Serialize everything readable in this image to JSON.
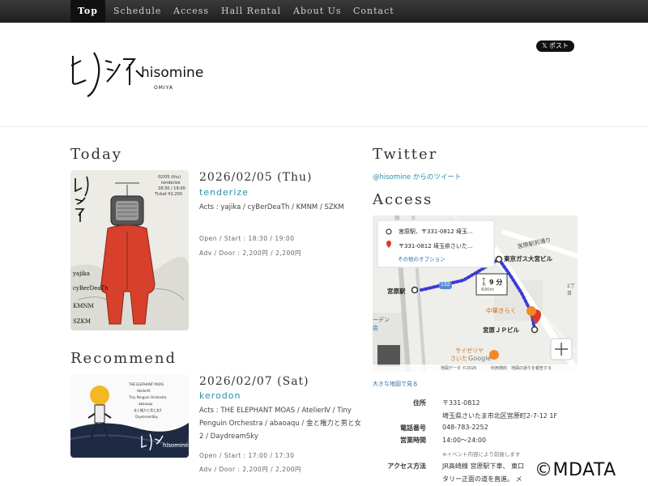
{
  "nav": {
    "items": [
      "Top",
      "Schedule",
      "Access",
      "Hall Rental",
      "About Us",
      "Contact"
    ]
  },
  "header": {
    "logo_text": "hisomine",
    "logo_sub": "OMIYA",
    "x_post": "𝕏 ポスト"
  },
  "today": {
    "heading": "Today",
    "date": "2026/02/05 (Thu)",
    "title": "tenderize",
    "acts": "Acts : yajika / cyBerDeaTh / KMNM / SZKM",
    "open_start": "Open / Start : 18:30 / 19:00",
    "adv_door": "Adv / Door : 2,200円 / 2,200円",
    "flyer": {
      "date": "02/05 (thu)",
      "title": "tenderize",
      "time": "18:30 / 19:00",
      "ticket": "Ticket ¥2,200",
      "names": [
        "yajika",
        "cyBerDeaTh",
        "KMNM",
        "SZKM"
      ]
    }
  },
  "recommend": {
    "heading": "Recommend",
    "date": "2026/02/07 (Sat)",
    "title": "kerodon",
    "acts": "Acts : THE ELEPHANT MOAS / AtelierⅣ / Tiny Penguin Orchestra / abaoaqu / 金と権力と男と女2 / DaydreamSky",
    "open_start": "Open / Start : 17:00 / 17:30",
    "adv_door": "Adv / Door : 2,200円 / 2,200円",
    "flyer": {
      "lines": [
        "THE ELEPHANT MOAS",
        "AtelierⅣ",
        "Tiny Penguin Orchestra",
        "abaoaqu",
        "金と権力と男と女2",
        "DaydreamSky"
      ]
    }
  },
  "twitter": {
    "heading": "Twitter",
    "link": "@hisomine からのツイート"
  },
  "access": {
    "heading": "Access",
    "map": {
      "from": "宮原駅、〒331-0812 埼玉...",
      "to": "〒331-0812 埼玉県さいた...",
      "options": "その他のオプション",
      "walk_time": "9 分",
      "walk_dist": "600m",
      "labels": {
        "tokyo_gas": "東京ガス大宮ビル",
        "miyahara_st": "宮原駅",
        "chuka": "中華きらく",
        "jp_bldg": "宮原ＪＰビル",
        "saizeriya": "サイゼリヤ",
        "saizeriya2": "さいた",
        "street": "宮原駅前通り",
        "chome": "2丁目",
        "route": "132",
        "den": "ーデン",
        "shop": "店",
        "google": "Google",
        "footer_left": "地図データ ©2026",
        "footer_right": "利用規約　地図の誤りを報告する"
      }
    },
    "map_link": "大きな地図で見る",
    "rows": [
      {
        "label": "住所",
        "lines": [
          "〒331-0812",
          "埼玉県さいたま市北区宮原町2-7-12 1F"
        ]
      },
      {
        "label": "電話番号",
        "lines": [
          "048-783-2252"
        ]
      },
      {
        "label": "営業時間",
        "lines": [
          "14:00〜24:00"
        ]
      },
      {
        "label": "アクセス方法",
        "lines": [
          "JR高崎線 宮原駅下車、 東口",
          "タリー正面の道を直進。 メ"
        ]
      }
    ],
    "hours_note": "※イベント内容により前後します"
  },
  "watermark": "©MDATA",
  "colors": {
    "accent": "#2a8fa8",
    "nav_bg": "#2a2a2a",
    "route": "#3b3bd6",
    "flyer_red": "#d7402a"
  }
}
